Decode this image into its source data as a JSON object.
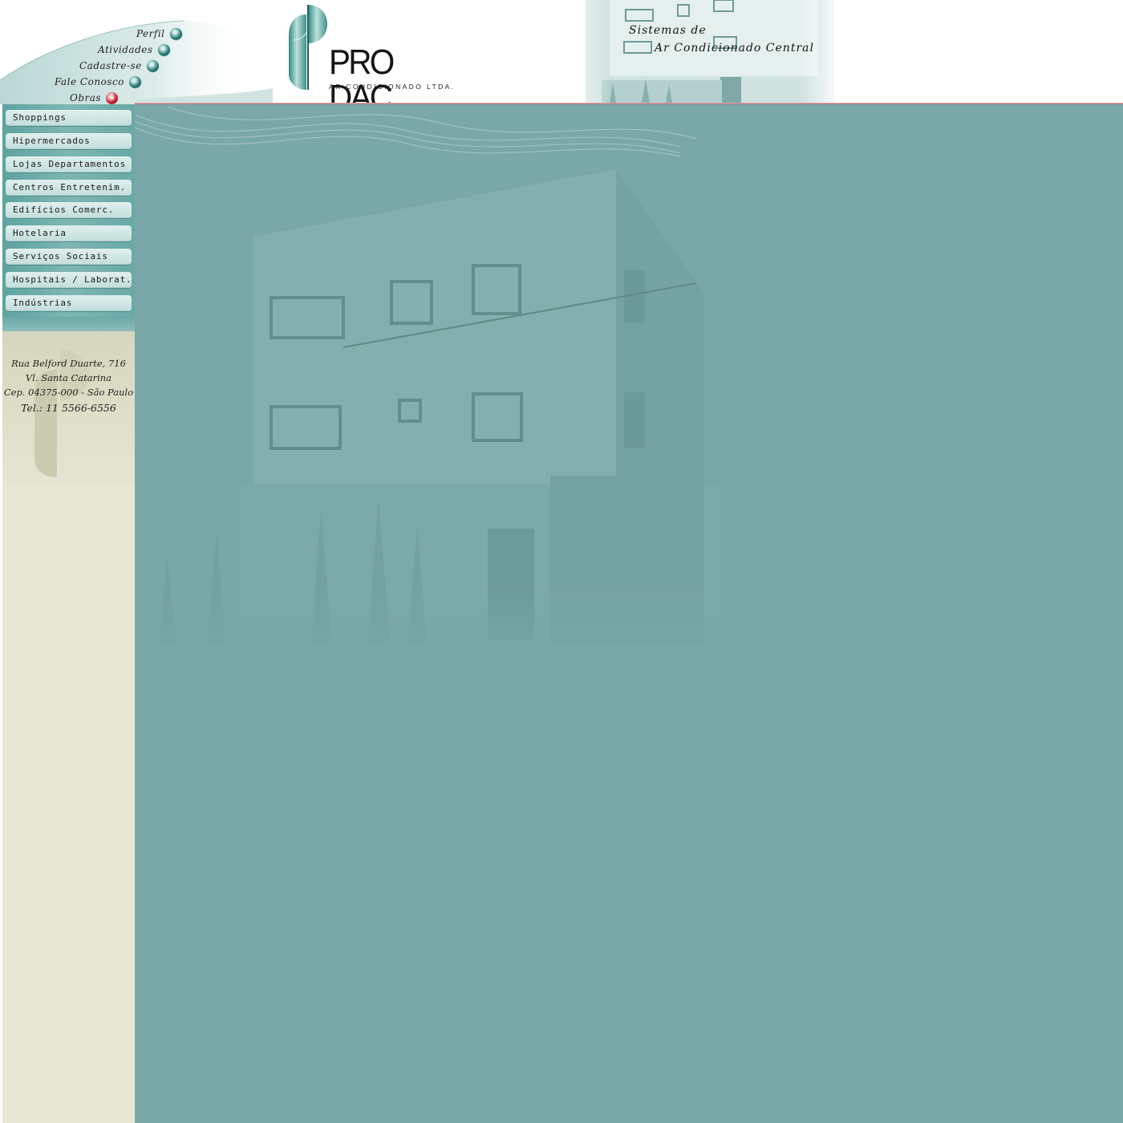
{
  "header": {
    "logo_name": "PRO DAC",
    "logo_subtitle": "AR CONDICIONADO LTDA.",
    "tagline_line1": "Sistemas de",
    "tagline_line2": "Ar Condicionado Central"
  },
  "top_nav": {
    "items": [
      {
        "label": "Perfil",
        "bullet": "teal-orb-icon"
      },
      {
        "label": "Atividades",
        "bullet": "teal-orb-icon"
      },
      {
        "label": "Cadastre-se",
        "bullet": "teal-orb-icon"
      },
      {
        "label": "Fale Conosco",
        "bullet": "teal-orb-icon"
      },
      {
        "label": "Obras",
        "bullet": "red-down-arrow-icon"
      }
    ]
  },
  "sidebar": {
    "items": [
      {
        "label": "Shoppings"
      },
      {
        "label": "Hipermercados"
      },
      {
        "label": "Lojas Departamentos"
      },
      {
        "label": "Centros Entretenim."
      },
      {
        "label": "Edifícios Comerc."
      },
      {
        "label": "Hotelaria"
      },
      {
        "label": "Serviços Sociais"
      },
      {
        "label": "Hospitais / Laborat."
      },
      {
        "label": "Indústrias"
      }
    ],
    "address": {
      "line1": "Rua Belford Duarte, 716",
      "line2": "Vl. Santa Catarina",
      "line3": "Cep. 04375-000 - São Paulo",
      "line4": "Tel.: 11 5566-6556"
    }
  },
  "colors": {
    "accent_teal": "#7aa8a8",
    "menu_teal": "#5da3a0",
    "accent_red": "#9e1e2a",
    "sidebar_beige": "#e8e7d6"
  }
}
